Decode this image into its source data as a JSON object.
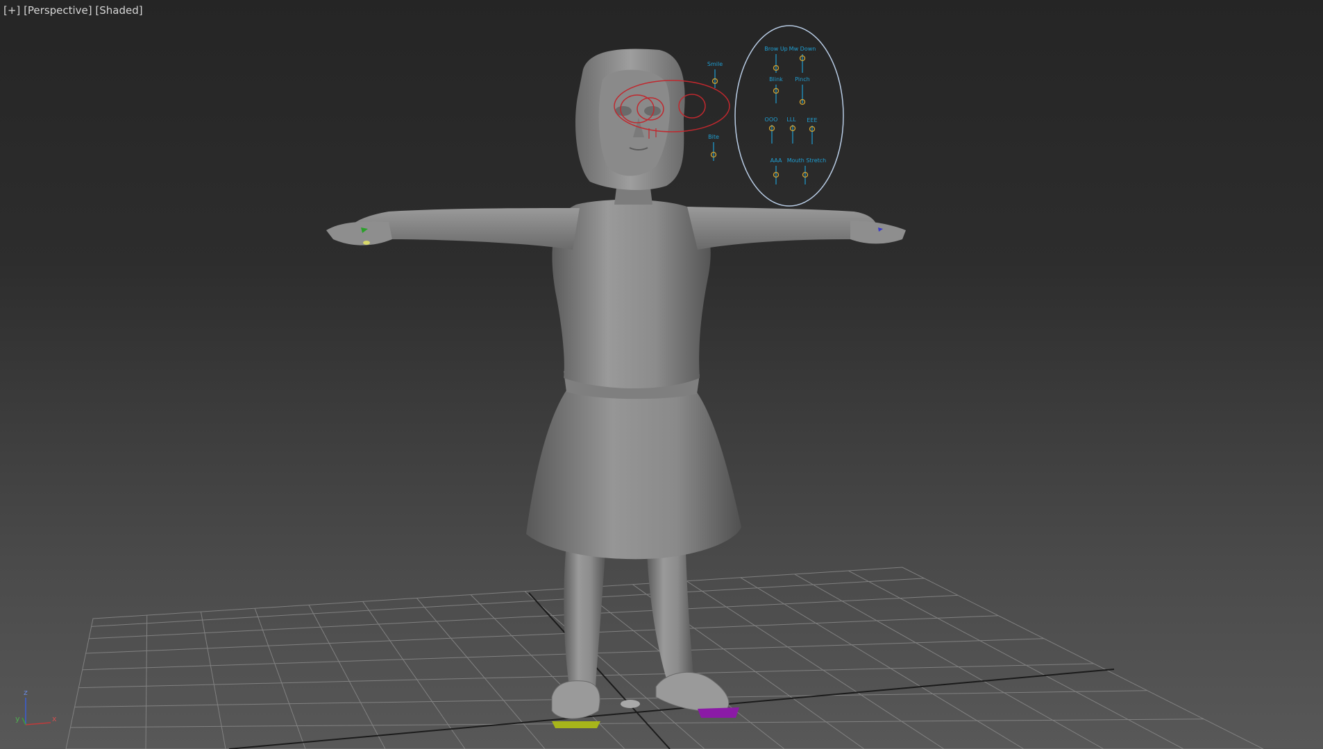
{
  "viewport": {
    "label_plus": "[+]",
    "label_view": "[Perspective]",
    "label_shading": "[Shaded]"
  },
  "face_controls": {
    "labels": [
      "Smile",
      "Brow Up",
      "Mw Down",
      "Blink",
      "Pinch",
      "OOO",
      "LLL",
      "EEE",
      "AAA",
      "Mouth Stretch",
      "Bite"
    ]
  },
  "axis_gizmo": {
    "z": "z",
    "x": "x",
    "y": "y"
  },
  "colors": {
    "viewport_top": "#252525",
    "viewport_bottom": "#585858",
    "grid": "#8a8a8a",
    "model": "#8e8e8e",
    "control_blue": "#1f9fd3",
    "control_red": "#c0282e",
    "control_yellow": "#d3a431",
    "foot_left": "#a7b51a",
    "foot_right": "#8b1aa6"
  }
}
